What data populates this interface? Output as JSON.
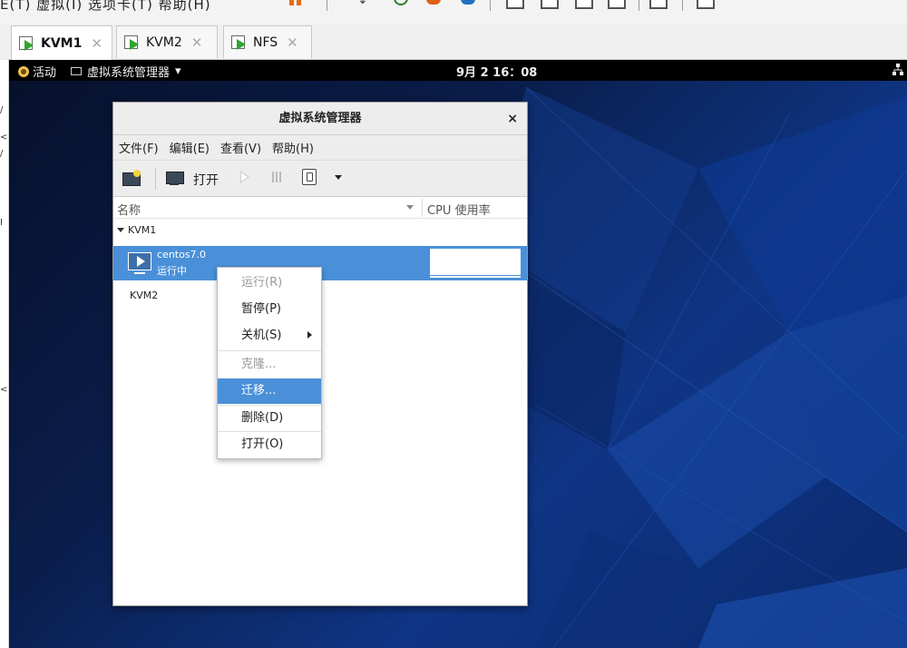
{
  "host": {
    "menu_text": "E(T) 虚拟(I) 选项卡(T) 帮助(H)",
    "tabs": [
      {
        "label": "KVM1",
        "active": true
      },
      {
        "label": "KVM2",
        "active": false
      },
      {
        "label": "NFS",
        "active": false
      }
    ],
    "left_edge_chars": [
      "/",
      "<",
      "/",
      "I",
      "<"
    ]
  },
  "guest_topbar": {
    "activities": "活动",
    "app_menu": "虚拟系统管理器",
    "clock": "9月 2 16：08"
  },
  "window": {
    "title": "虚拟系统管理器",
    "close": "×",
    "menus": [
      "文件(F)",
      "编辑(E)",
      "查看(V)",
      "帮助(H)"
    ],
    "toolbar": {
      "open_label": "打开"
    },
    "columns": {
      "name": "名称",
      "cpu": "CPU 使用率"
    },
    "groups": [
      {
        "name": "KVM1",
        "vms": [
          {
            "name": "centos7.0",
            "status": "运行中"
          }
        ]
      },
      {
        "name": "KVM2",
        "vms": []
      }
    ]
  },
  "context_menu": {
    "items": [
      {
        "label": "运行(R)",
        "disabled": true
      },
      {
        "label": "暂停(P)",
        "disabled": false
      },
      {
        "label": "关机(S)",
        "disabled": false,
        "submenu": true
      },
      {
        "label": "克隆...",
        "disabled": true
      },
      {
        "label": "迁移...",
        "disabled": false,
        "highlight": true
      },
      {
        "label": "删除(D)",
        "disabled": false
      },
      {
        "label": "打开(O)",
        "disabled": false
      }
    ]
  },
  "colors": {
    "selection": "#4a90d9",
    "desktop_dark": "#06102a",
    "desktop_blue": "#0f3585",
    "running_green": "#2fa52f"
  }
}
